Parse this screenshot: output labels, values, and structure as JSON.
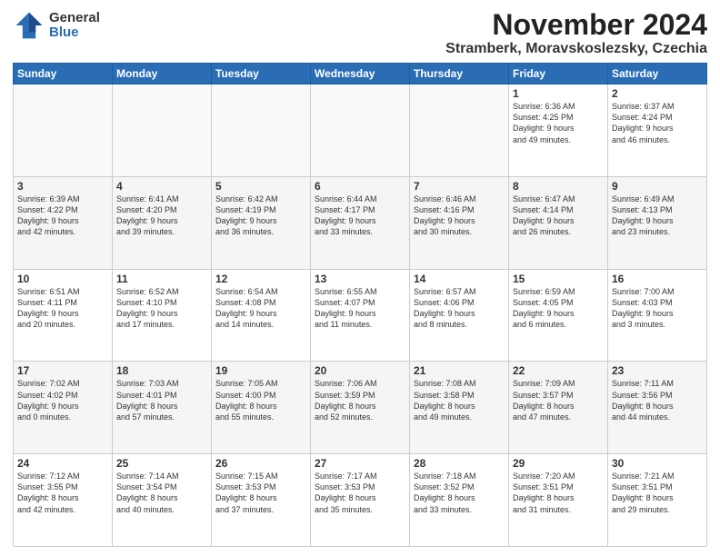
{
  "logo": {
    "general": "General",
    "blue": "Blue"
  },
  "title": "November 2024",
  "subtitle": "Stramberk, Moravskoslezsky, Czechia",
  "days_header": [
    "Sunday",
    "Monday",
    "Tuesday",
    "Wednesday",
    "Thursday",
    "Friday",
    "Saturday"
  ],
  "weeks": [
    [
      {
        "day": "",
        "info": ""
      },
      {
        "day": "",
        "info": ""
      },
      {
        "day": "",
        "info": ""
      },
      {
        "day": "",
        "info": ""
      },
      {
        "day": "",
        "info": ""
      },
      {
        "day": "1",
        "info": "Sunrise: 6:36 AM\nSunset: 4:25 PM\nDaylight: 9 hours\nand 49 minutes."
      },
      {
        "day": "2",
        "info": "Sunrise: 6:37 AM\nSunset: 4:24 PM\nDaylight: 9 hours\nand 46 minutes."
      }
    ],
    [
      {
        "day": "3",
        "info": "Sunrise: 6:39 AM\nSunset: 4:22 PM\nDaylight: 9 hours\nand 42 minutes."
      },
      {
        "day": "4",
        "info": "Sunrise: 6:41 AM\nSunset: 4:20 PM\nDaylight: 9 hours\nand 39 minutes."
      },
      {
        "day": "5",
        "info": "Sunrise: 6:42 AM\nSunset: 4:19 PM\nDaylight: 9 hours\nand 36 minutes."
      },
      {
        "day": "6",
        "info": "Sunrise: 6:44 AM\nSunset: 4:17 PM\nDaylight: 9 hours\nand 33 minutes."
      },
      {
        "day": "7",
        "info": "Sunrise: 6:46 AM\nSunset: 4:16 PM\nDaylight: 9 hours\nand 30 minutes."
      },
      {
        "day": "8",
        "info": "Sunrise: 6:47 AM\nSunset: 4:14 PM\nDaylight: 9 hours\nand 26 minutes."
      },
      {
        "day": "9",
        "info": "Sunrise: 6:49 AM\nSunset: 4:13 PM\nDaylight: 9 hours\nand 23 minutes."
      }
    ],
    [
      {
        "day": "10",
        "info": "Sunrise: 6:51 AM\nSunset: 4:11 PM\nDaylight: 9 hours\nand 20 minutes."
      },
      {
        "day": "11",
        "info": "Sunrise: 6:52 AM\nSunset: 4:10 PM\nDaylight: 9 hours\nand 17 minutes."
      },
      {
        "day": "12",
        "info": "Sunrise: 6:54 AM\nSunset: 4:08 PM\nDaylight: 9 hours\nand 14 minutes."
      },
      {
        "day": "13",
        "info": "Sunrise: 6:55 AM\nSunset: 4:07 PM\nDaylight: 9 hours\nand 11 minutes."
      },
      {
        "day": "14",
        "info": "Sunrise: 6:57 AM\nSunset: 4:06 PM\nDaylight: 9 hours\nand 8 minutes."
      },
      {
        "day": "15",
        "info": "Sunrise: 6:59 AM\nSunset: 4:05 PM\nDaylight: 9 hours\nand 6 minutes."
      },
      {
        "day": "16",
        "info": "Sunrise: 7:00 AM\nSunset: 4:03 PM\nDaylight: 9 hours\nand 3 minutes."
      }
    ],
    [
      {
        "day": "17",
        "info": "Sunrise: 7:02 AM\nSunset: 4:02 PM\nDaylight: 9 hours\nand 0 minutes."
      },
      {
        "day": "18",
        "info": "Sunrise: 7:03 AM\nSunset: 4:01 PM\nDaylight: 8 hours\nand 57 minutes."
      },
      {
        "day": "19",
        "info": "Sunrise: 7:05 AM\nSunset: 4:00 PM\nDaylight: 8 hours\nand 55 minutes."
      },
      {
        "day": "20",
        "info": "Sunrise: 7:06 AM\nSunset: 3:59 PM\nDaylight: 8 hours\nand 52 minutes."
      },
      {
        "day": "21",
        "info": "Sunrise: 7:08 AM\nSunset: 3:58 PM\nDaylight: 8 hours\nand 49 minutes."
      },
      {
        "day": "22",
        "info": "Sunrise: 7:09 AM\nSunset: 3:57 PM\nDaylight: 8 hours\nand 47 minutes."
      },
      {
        "day": "23",
        "info": "Sunrise: 7:11 AM\nSunset: 3:56 PM\nDaylight: 8 hours\nand 44 minutes."
      }
    ],
    [
      {
        "day": "24",
        "info": "Sunrise: 7:12 AM\nSunset: 3:55 PM\nDaylight: 8 hours\nand 42 minutes."
      },
      {
        "day": "25",
        "info": "Sunrise: 7:14 AM\nSunset: 3:54 PM\nDaylight: 8 hours\nand 40 minutes."
      },
      {
        "day": "26",
        "info": "Sunrise: 7:15 AM\nSunset: 3:53 PM\nDaylight: 8 hours\nand 37 minutes."
      },
      {
        "day": "27",
        "info": "Sunrise: 7:17 AM\nSunset: 3:53 PM\nDaylight: 8 hours\nand 35 minutes."
      },
      {
        "day": "28",
        "info": "Sunrise: 7:18 AM\nSunset: 3:52 PM\nDaylight: 8 hours\nand 33 minutes."
      },
      {
        "day": "29",
        "info": "Sunrise: 7:20 AM\nSunset: 3:51 PM\nDaylight: 8 hours\nand 31 minutes."
      },
      {
        "day": "30",
        "info": "Sunrise: 7:21 AM\nSunset: 3:51 PM\nDaylight: 8 hours\nand 29 minutes."
      }
    ]
  ]
}
